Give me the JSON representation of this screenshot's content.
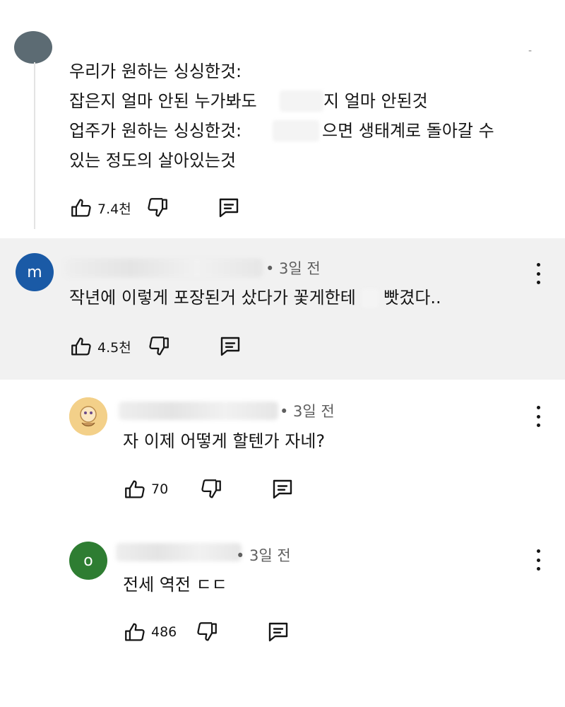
{
  "comments": [
    {
      "lines": [
        "우리가 원하는 싱싱한것:",
        "잡은지 얼마 안된 누가봐도",
        "지 얼마 안된것",
        "업주가 원하는 싱싱한것:",
        "으면 생태계로 돌아갈 수",
        "있는 정도의 살아있는것"
      ],
      "likes": "7.4천"
    },
    {
      "avatar_letter": "m",
      "avatar_color": "#1a5aa6",
      "time": "• 3일 전",
      "text_a": "작년에 이렇게 포장된거 샀다가 꽃게한테",
      "text_b": "빳겼다..",
      "likes": "4.5천"
    },
    {
      "avatar_color": "#f3d089",
      "time": "• 3일 전",
      "text": "자 이제 어떻게 할텐가 자네?",
      "likes": "70"
    },
    {
      "avatar_letter": "o",
      "avatar_color": "#2e7d32",
      "time": "• 3일 전",
      "text": "전세 역전 ㄷㄷ",
      "likes": "486"
    }
  ]
}
